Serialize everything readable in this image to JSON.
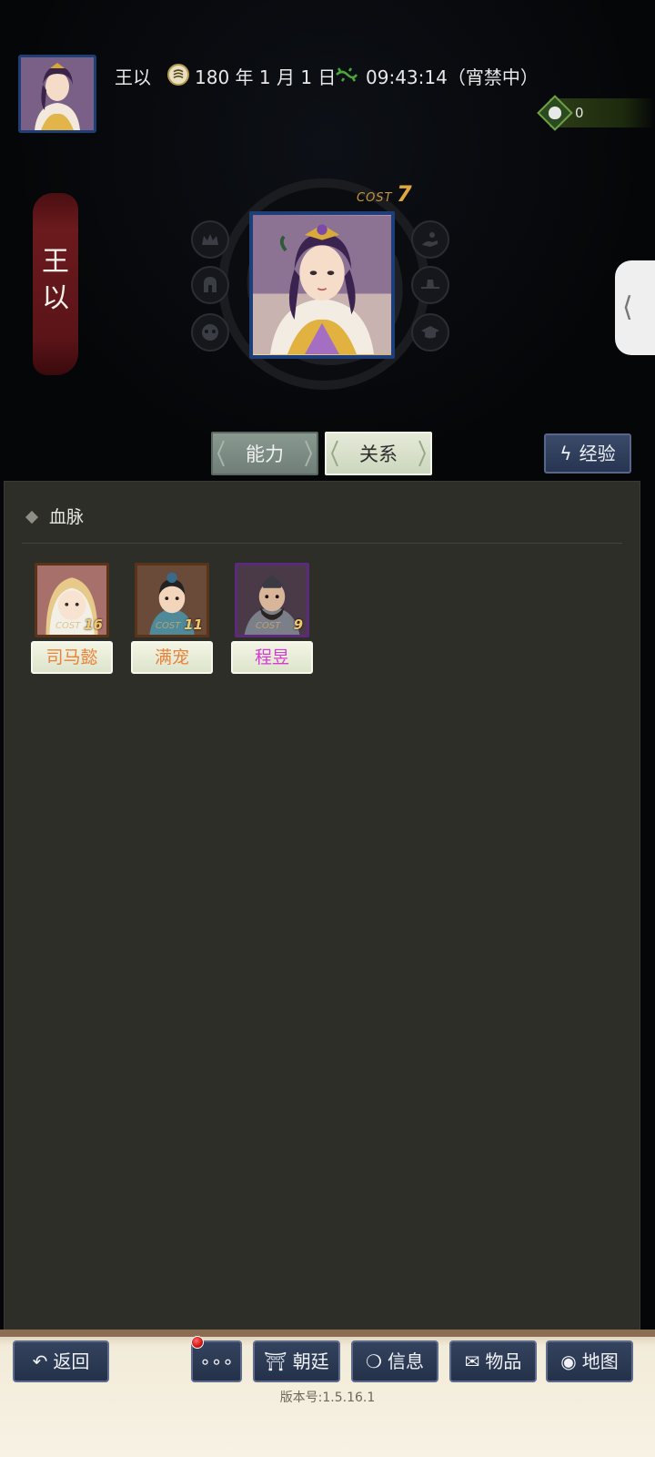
{
  "header": {
    "character_name": "王以",
    "date": "180 年 1 月 1 日",
    "time": "09:43:14（宵禁中）",
    "currency_value": "0",
    "calendar_icon": "calendar-seal-icon",
    "time_icon": "lizard-clock-icon"
  },
  "profile": {
    "banner_name_line1": "王",
    "banner_name_line2": "以",
    "cost_label": "COST",
    "cost_value": "7"
  },
  "tabs": [
    {
      "label": "能力",
      "active": false
    },
    {
      "label": "关系",
      "active": true
    }
  ],
  "exp_button": {
    "label": "经验",
    "icon": "lightning-icon"
  },
  "bloodline": {
    "title": "血脉",
    "members": [
      {
        "name": "司马懿",
        "cost_label": "COST",
        "cost": "16",
        "name_color": "#e8823a"
      },
      {
        "name": "满宠",
        "cost_label": "COST",
        "cost": "11",
        "name_color": "#e8823a"
      },
      {
        "name": "程昱",
        "cost_label": "COST",
        "cost": "9",
        "name_color": "#d63ad6"
      }
    ]
  },
  "nav": {
    "back": "返回",
    "more": "∘∘∘",
    "court": "朝廷",
    "info": "信息",
    "items": "物品",
    "map": "地图"
  },
  "version": "版本号:1.5.16.1",
  "colors": {
    "accent_cost": "#e0a73f",
    "banner_red": "#6b1a1d",
    "panel_bg": "#2e2e29",
    "nav_btn": "#24314a"
  }
}
